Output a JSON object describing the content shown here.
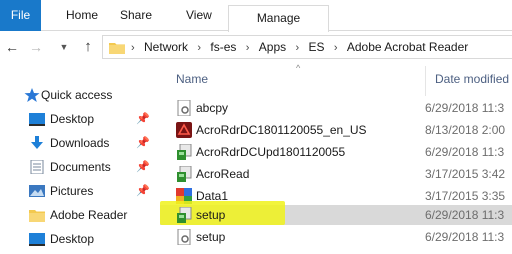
{
  "ribbon": {
    "tabs": [
      "File",
      "Home",
      "Share",
      "View",
      "Manage"
    ]
  },
  "address": {
    "crumbs": [
      "Network",
      "fs-es",
      "Apps",
      "ES",
      "Adobe Acrobat Reader"
    ]
  },
  "nav": {
    "quick_access": "Quick access",
    "items": [
      {
        "label": "Desktop",
        "icon": "desktop-icon",
        "pinned": true
      },
      {
        "label": "Downloads",
        "icon": "download-icon",
        "pinned": true
      },
      {
        "label": "Documents",
        "icon": "documents-icon",
        "pinned": true
      },
      {
        "label": "Pictures",
        "icon": "pictures-icon",
        "pinned": true
      },
      {
        "label": "Adobe Reader",
        "icon": "folder-icon",
        "pinned": false
      },
      {
        "label": "Desktop",
        "icon": "desktop-icon",
        "pinned": false
      }
    ]
  },
  "files": {
    "columns": {
      "name": "Name",
      "date": "Date modified"
    },
    "rows": [
      {
        "name": "abcpy",
        "date": "6/29/2018 11:3",
        "icon": "file-gear-icon"
      },
      {
        "name": "AcroRdrDC1801120055_en_US",
        "date": "8/13/2018 2:00",
        "icon": "acrobat-icon"
      },
      {
        "name": "AcroRdrDCUpd1801120055",
        "date": "6/29/2018 11:3",
        "icon": "installer-icon"
      },
      {
        "name": "AcroRead",
        "date": "3/17/2015 3:42",
        "icon": "installer-icon"
      },
      {
        "name": "Data1",
        "date": "3/17/2015 3:35",
        "icon": "cab-icon"
      },
      {
        "name": "setup",
        "date": "6/29/2018 11:3",
        "icon": "installer-icon"
      },
      {
        "name": "setup",
        "date": "6/29/2018 11:3",
        "icon": "file-gear-icon"
      }
    ]
  },
  "colors": {
    "file_tab": "#1979ca",
    "highlight": "#f0f21a",
    "selection": "#d9d9d9",
    "header_text": "#4d6082"
  }
}
